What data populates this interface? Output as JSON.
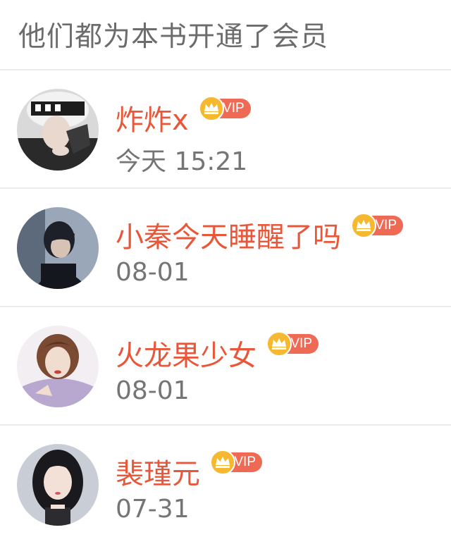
{
  "header": {
    "title": "他们都为本书开通了会员"
  },
  "members": [
    {
      "name": "炸炸x",
      "badge": "VIP",
      "time": "今天 15:21",
      "avatar_icon": "avatar-photo"
    },
    {
      "name": "小秦今天睡醒了吗",
      "badge": "VIP",
      "time": "08-01",
      "avatar_icon": "avatar-photo"
    },
    {
      "name": "火龙果少女",
      "badge": "VIP",
      "time": "08-01",
      "avatar_icon": "avatar-photo"
    },
    {
      "name": "裴瑾元",
      "badge": "VIP",
      "time": "07-31",
      "avatar_icon": "avatar-photo"
    }
  ],
  "colors": {
    "name": "#e8573a",
    "vip_pill": "#ee6a55",
    "crown": "#f5b82e",
    "time": "#757575",
    "title": "#6c6c6c",
    "divider": "#ececec"
  }
}
